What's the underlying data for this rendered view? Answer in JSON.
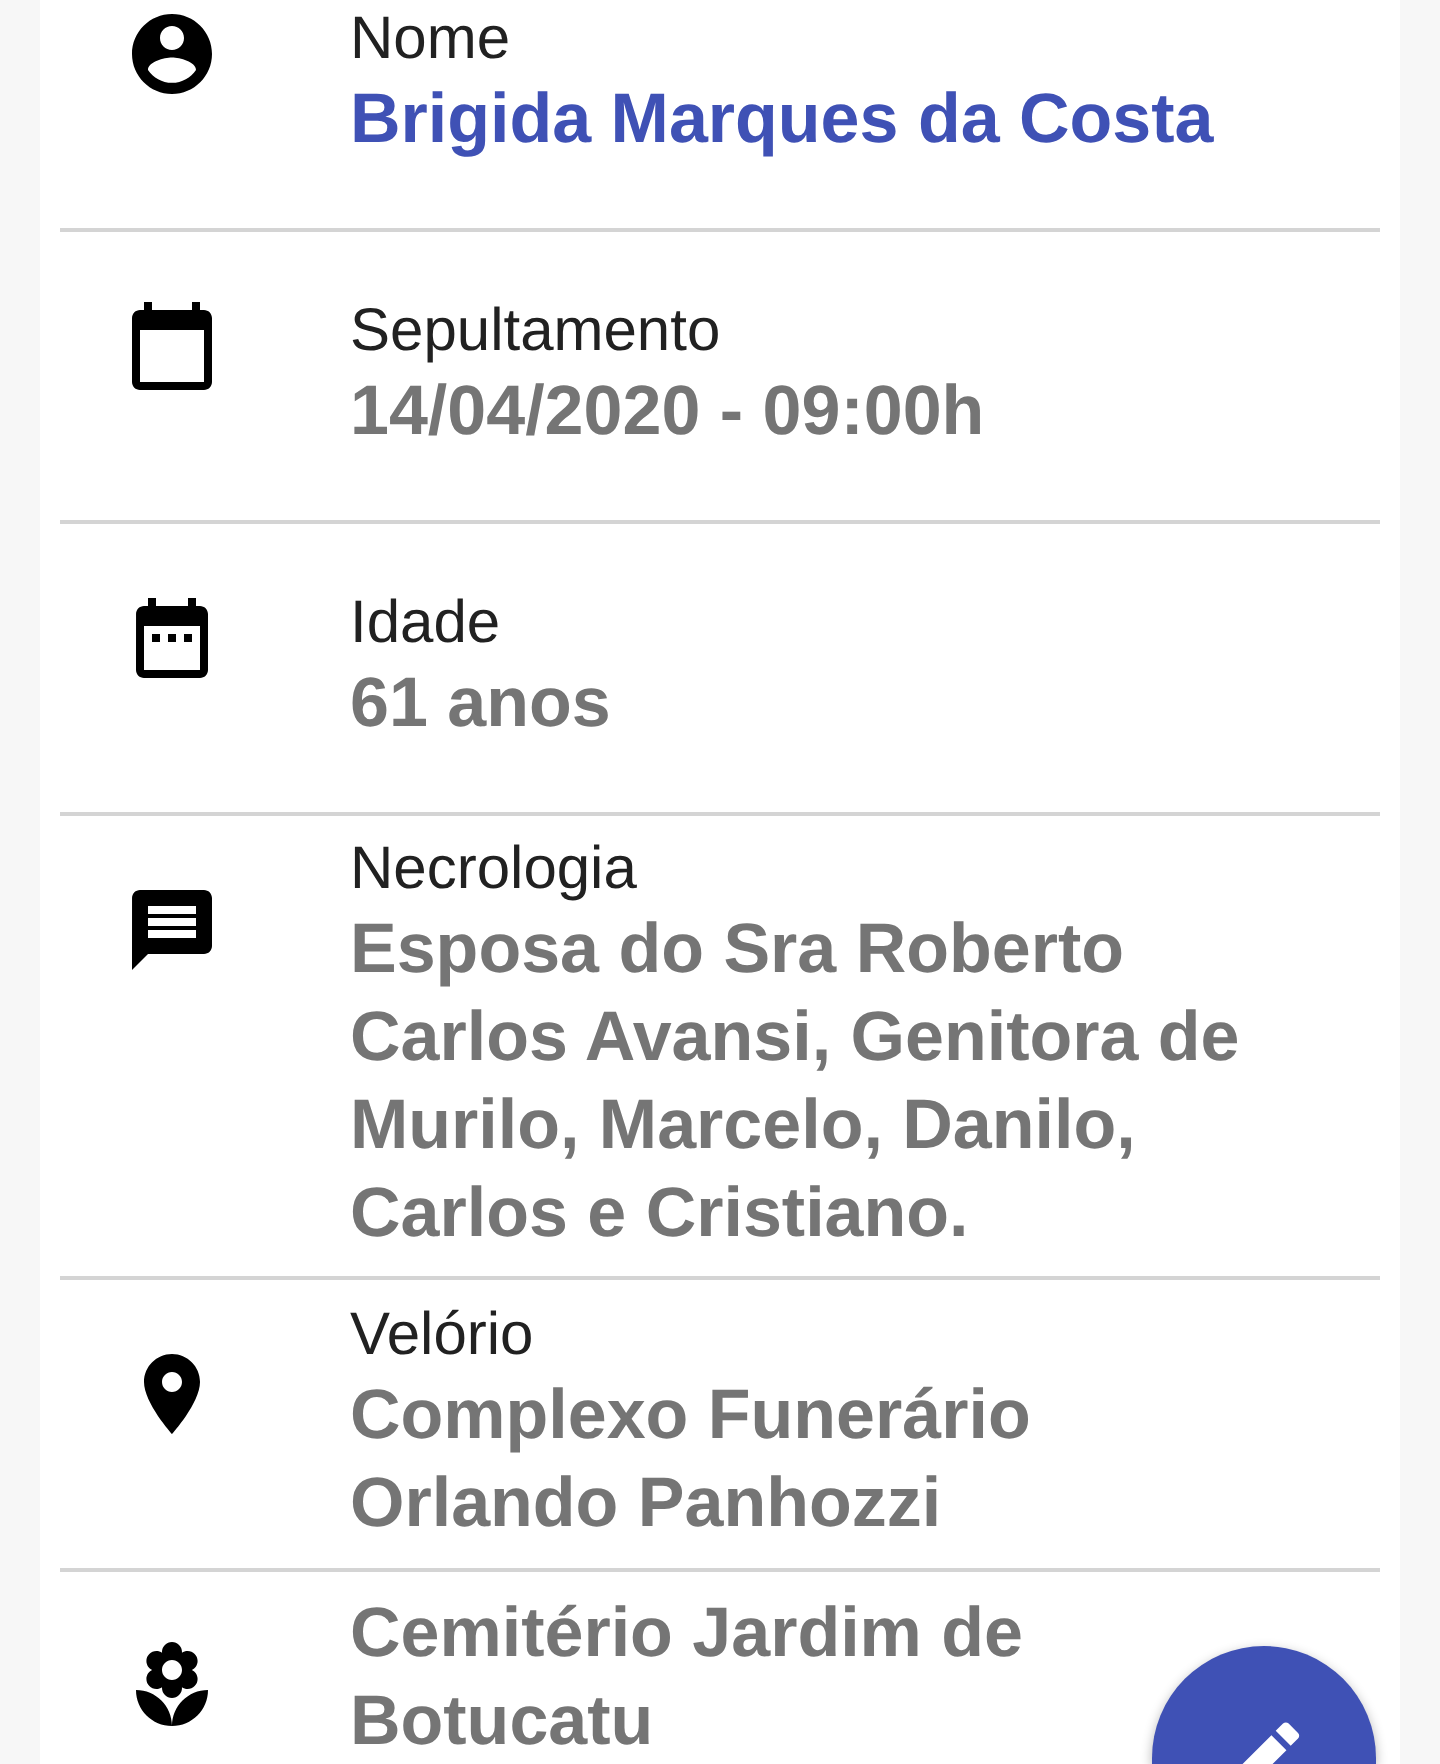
{
  "fields": [
    {
      "label": "Nome",
      "value": "Brigida Marques da Costa",
      "highlighted": true
    },
    {
      "label": "Sepultamento",
      "value": "14/04/2020 - 09:00h",
      "highlighted": false
    },
    {
      "label": "Idade",
      "value": "61 anos",
      "highlighted": false
    },
    {
      "label": "Necrologia",
      "value": "Esposa do Sra Roberto Carlos Avansi, Genitora de Murilo, Marcelo, Danilo, Carlos e Cristiano.",
      "highlighted": false
    },
    {
      "label": "Velório",
      "value": "Complexo Funerário Orlando Panhozzi",
      "highlighted": false
    },
    {
      "value": "Cemitério Jardim de Botucatu",
      "highlighted": false
    }
  ]
}
